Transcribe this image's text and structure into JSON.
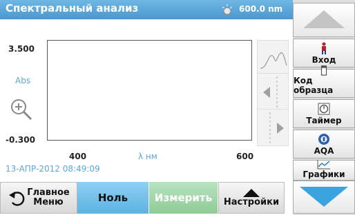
{
  "header": {
    "title": "Спектральный анализ",
    "wavelength": "600.0 nm"
  },
  "plot": {
    "y_max": "3.500",
    "y_min": "-0.300",
    "y_unit": "Abs",
    "x_min": "400",
    "x_max": "600",
    "x_unit": "λ нм"
  },
  "status": {
    "datetime": "13-АПР-2012  08:49:09"
  },
  "toolbar": {
    "home_label_line1": "Главное",
    "home_label_line2": "Меню",
    "zero_label": "Ноль",
    "measure_label": "Измерить",
    "settings_label": "Настройки"
  },
  "side_menu": {
    "items": [
      {
        "label": "Вход",
        "icon": "person-icon"
      },
      {
        "label": "Код образца",
        "icon": "sample-vial-icon"
      },
      {
        "label": "Таймер",
        "icon": "timer-icon"
      },
      {
        "label": "AQA",
        "icon": "aqa-icon"
      },
      {
        "label": "Графики",
        "icon": "graph-icon"
      }
    ]
  },
  "colors": {
    "header": "#4a98d0",
    "accent": "#5aa7d6",
    "measure_disabled": "#8fcb97",
    "zero_button": "#5cb2e1"
  }
}
